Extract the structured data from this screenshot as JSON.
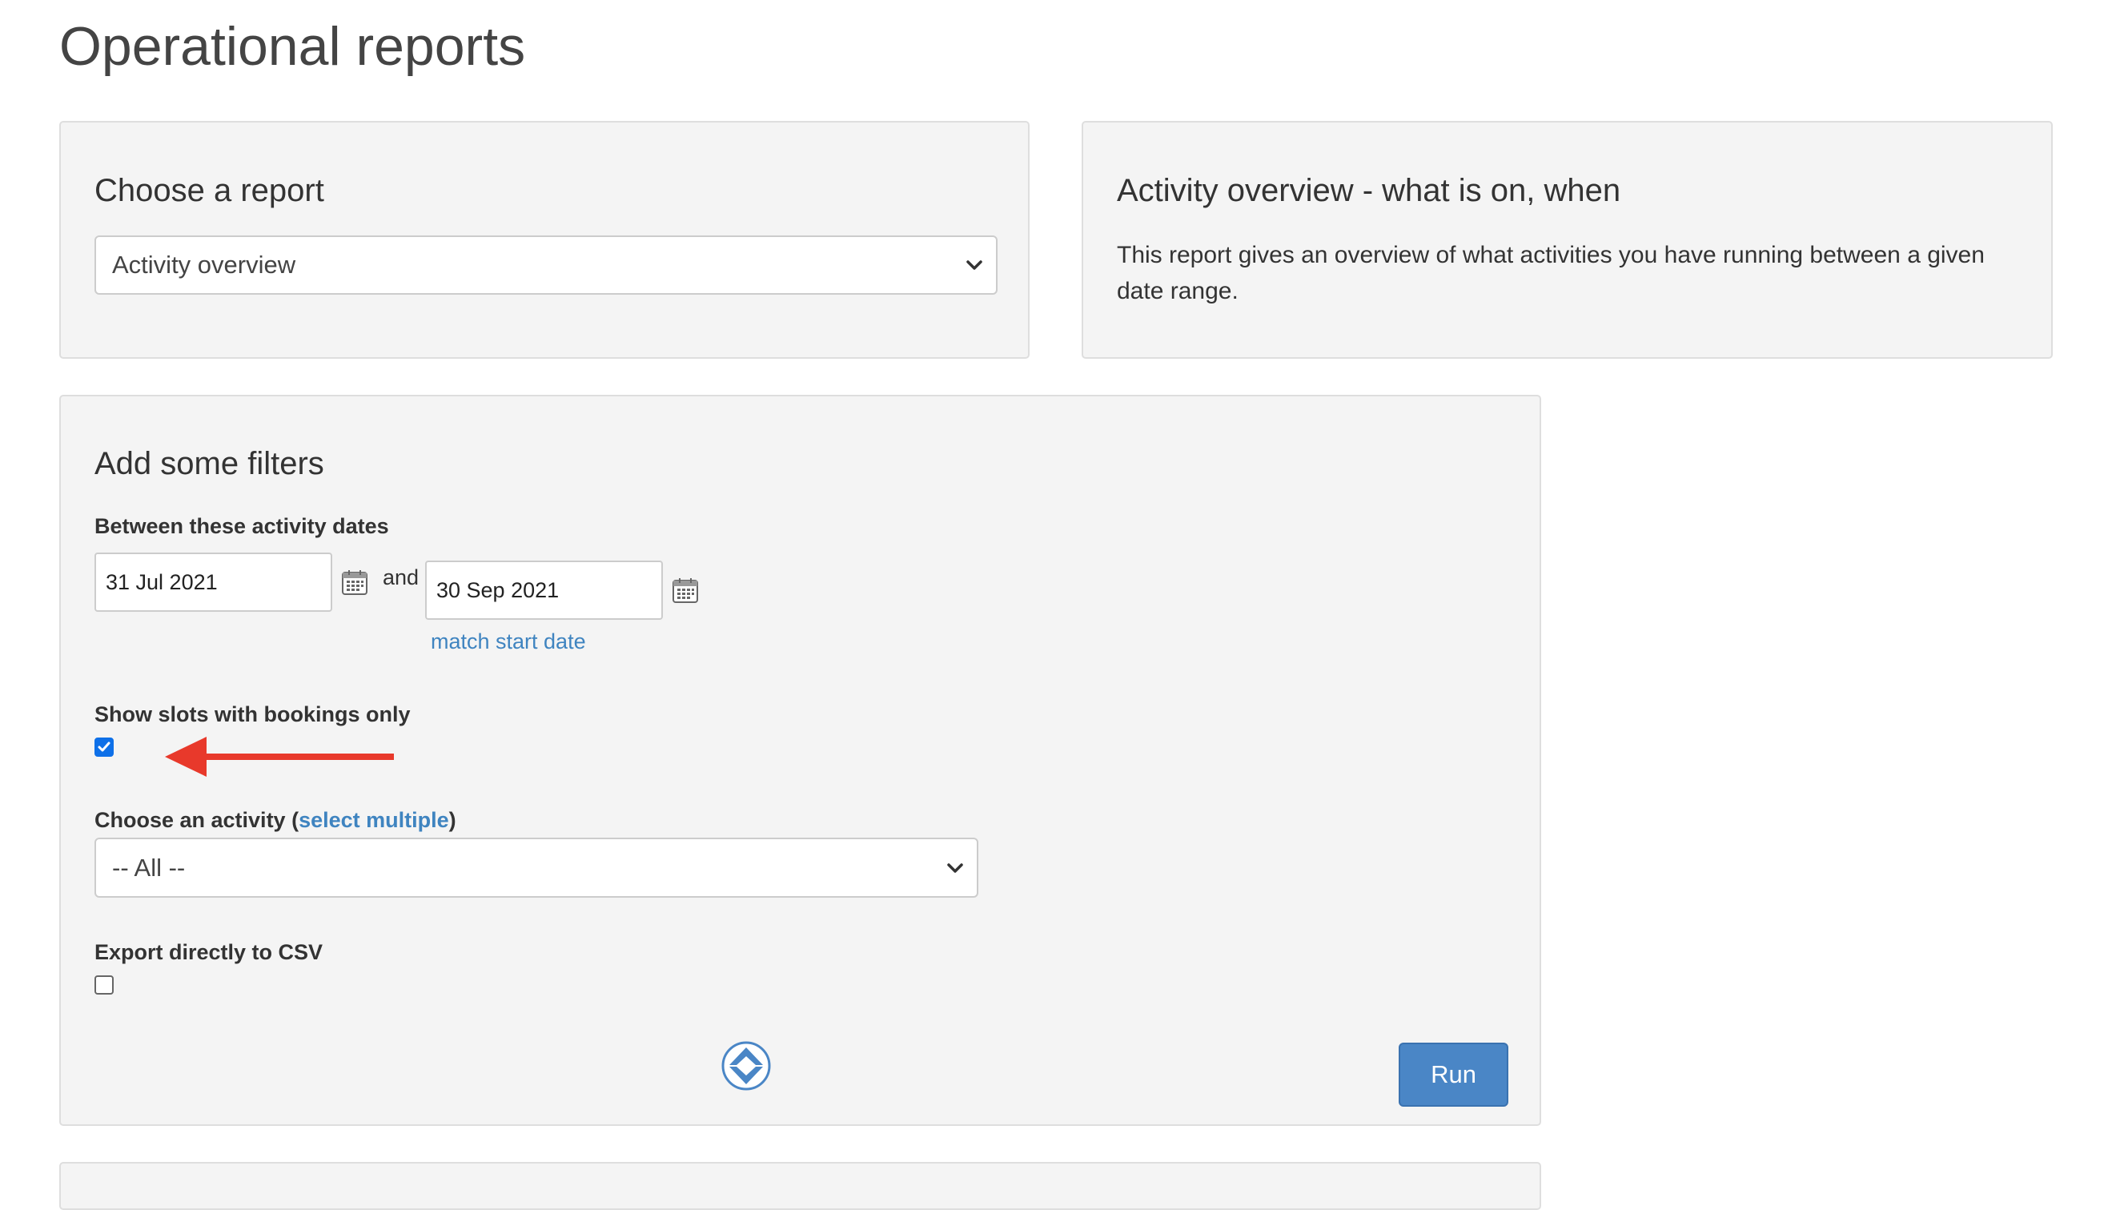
{
  "page": {
    "title": "Operational reports"
  },
  "choose_report": {
    "heading": "Choose a report",
    "selected": "Activity overview"
  },
  "description": {
    "heading": "Activity overview - what is on, when",
    "text": "This report gives an overview of what activities you have running between a given date range."
  },
  "filters": {
    "heading": "Add some filters",
    "dates_label": "Between these activity dates",
    "start_date": "31 Jul 2021",
    "and_text": "and",
    "end_date": "30 Sep 2021",
    "match_link": "match start date",
    "slots_label": "Show slots with bookings only",
    "slots_checked": true,
    "activity_label_prefix": "Choose an activity (",
    "activity_label_link": "select multiple",
    "activity_label_suffix": ")",
    "activity_selected": "-- All --",
    "csv_label": "Export directly to CSV",
    "csv_checked": false,
    "run_label": "Run"
  },
  "colors": {
    "link": "#3f84c0",
    "run_button": "#4a86c6",
    "annotation_arrow": "#e8392b",
    "checkbox_checked": "#0e70e8"
  },
  "icons": {
    "date_picker": "calendar-icon",
    "expand": "expand-collapse-icon",
    "dropdown": "chevron-down-icon",
    "annotation": "arrow-left-icon"
  }
}
